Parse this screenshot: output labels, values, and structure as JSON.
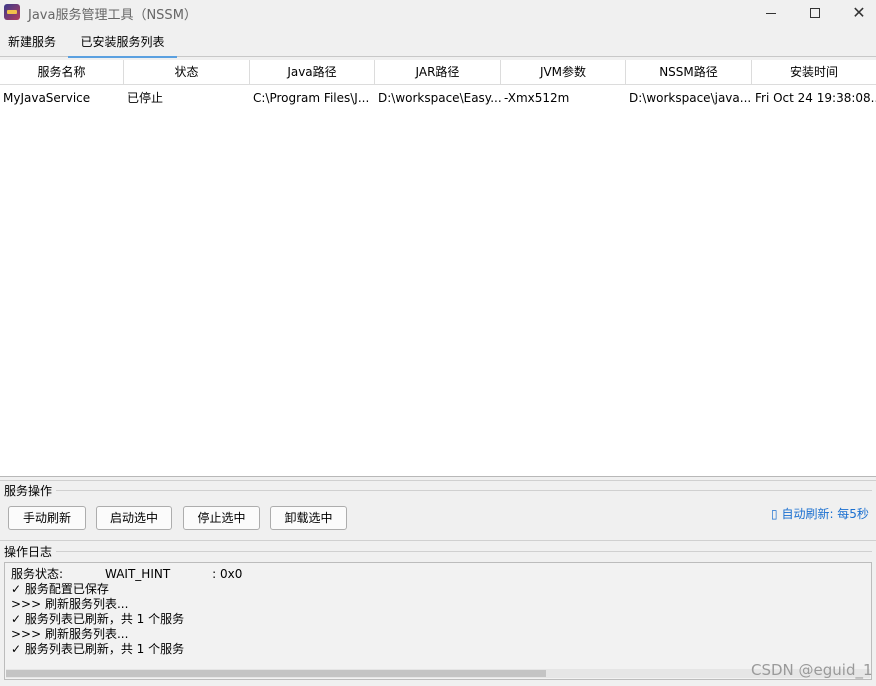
{
  "window": {
    "title": "Java服务管理工具（NSSM）",
    "minimize": "minimize-icon",
    "maximize": "maximize-icon",
    "close_glyph": "✕"
  },
  "tabs": [
    {
      "label": "新建服务",
      "active": false
    },
    {
      "label": "已安装服务列表",
      "active": true
    }
  ],
  "table": {
    "headers": [
      "服务名称",
      "状态",
      "Java路径",
      "JAR路径",
      "JVM参数",
      "NSSM路径",
      "安装时间"
    ],
    "rows": [
      [
        "MyJavaService",
        "已停止",
        "C:\\Program Files\\J...",
        "D:\\workspace\\Easy...",
        "-Xmx512m",
        "D:\\workspace\\java...",
        "Fri Oct 24 19:38:08..."
      ]
    ]
  },
  "operations": {
    "label": "服务操作",
    "buttons": [
      "手动刷新",
      "启动选中",
      "停止选中",
      "卸载选中"
    ],
    "auto_refresh": "自动刷新: 每5秒",
    "auto_refresh_icon": "▯"
  },
  "log": {
    "label": "操作日志",
    "lines": [
      "服务状态:           WAIT_HINT           : 0x0",
      "✓ 服务配置已保存",
      ">>> 刷新服务列表...",
      "✓ 服务列表已刷新，共 1 个服务",
      ">>> 刷新服务列表...",
      "✓ 服务列表已刷新，共 1 个服务"
    ]
  },
  "watermark": "CSDN @eguid_1",
  "colors": {
    "accent": "#5aa0e0",
    "link": "#1a6fd0",
    "background": "#f0f0f0"
  }
}
